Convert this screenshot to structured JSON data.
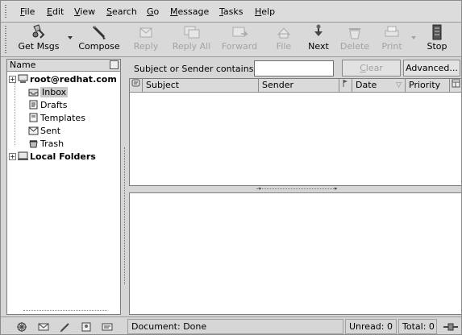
{
  "menubar": {
    "items": [
      {
        "label": "File",
        "key": "F",
        "rest": "ile"
      },
      {
        "label": "Edit",
        "key": "E",
        "rest": "dit"
      },
      {
        "label": "View",
        "key": "V",
        "rest": "iew"
      },
      {
        "label": "Search",
        "key": "S",
        "rest": "earch"
      },
      {
        "label": "Go",
        "key": "G",
        "rest": "o"
      },
      {
        "label": "Message",
        "key": "M",
        "rest": "essage"
      },
      {
        "label": "Tasks",
        "key": "T",
        "rest": "asks"
      },
      {
        "label": "Help",
        "key": "H",
        "rest": "elp"
      }
    ]
  },
  "toolbar": {
    "get_msgs": "Get Msgs",
    "compose": "Compose",
    "reply": "Reply",
    "reply_all": "Reply All",
    "forward": "Forward",
    "file": "File",
    "next": "Next",
    "delete": "Delete",
    "print": "Print",
    "stop": "Stop"
  },
  "folder_pane": {
    "header": "Name",
    "account": "root@redhat.com",
    "folders": [
      "Inbox",
      "Drafts",
      "Templates",
      "Sent",
      "Trash"
    ],
    "selected": "Inbox",
    "local": "Local Folders",
    "expander": "+"
  },
  "search": {
    "label": "Subject or Sender contains:",
    "value": "",
    "clear_key": "C",
    "clear_rest": "lear",
    "advanced": "Advanced..."
  },
  "message_list": {
    "columns": [
      "Subject",
      "Sender",
      "Date",
      "Priority"
    ]
  },
  "status": {
    "document": "Document: Done",
    "unread": "Unread: 0",
    "total": "Total: 0"
  },
  "colors": {
    "window_bg": "#d6d6d6",
    "pane_bg": "#ffffff",
    "disabled_text": "#a3a3a3"
  }
}
